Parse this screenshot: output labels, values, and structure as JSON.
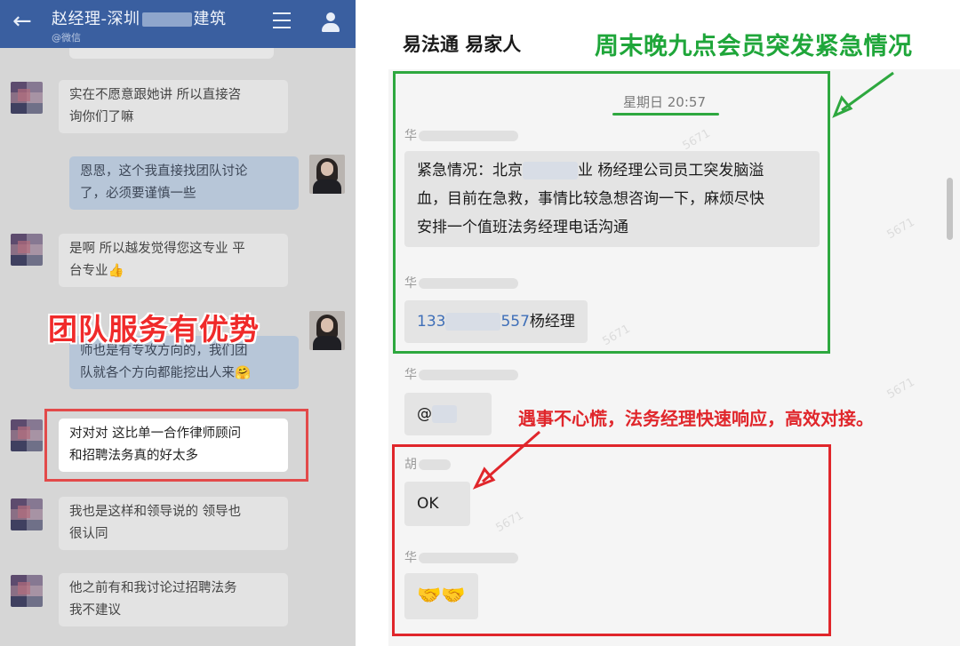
{
  "left_chat": {
    "title_start": "赵经理-深圳",
    "title_end": "建筑",
    "subtitle": "@微信",
    "messages": [
      {
        "side": "left",
        "text": "实在不愿意跟她讲 所以直接咨\n询你们了嘛"
      },
      {
        "side": "right",
        "text": "恩恩，这个我直接找团队讨论\n了，必须要谨慎一些"
      },
      {
        "side": "left",
        "text": "是啊 所以越发觉得您这专业 平\n台专业👍"
      },
      {
        "side": "right",
        "text": "师也是有专攻方向的，我们团\n队就各个方向都能挖出人来🤗"
      },
      {
        "side": "left",
        "text": "对对对 这比单一合作律师顾问\n和招聘法务真的好太多"
      },
      {
        "side": "left",
        "text": "我也是这样和领导说的 领导也\n很认同"
      },
      {
        "side": "left",
        "text": "他之前有和我讨论过招聘法务\n我不建议"
      }
    ],
    "overlay_caption": "团队服务有优势"
  },
  "right_chat": {
    "group_name": "易法通 易家人",
    "green_headline": "周末晚九点会员突发紧急情况",
    "timestamp": "星期日 20:57",
    "sender_hua": "华",
    "sender_hu": "胡",
    "urgent_msg_line1_start": "紧急情况：北京",
    "urgent_msg_line1_end": "业  杨经理公司员工突发脑溢",
    "urgent_msg_line2": "血，目前在急救，事情比较急想咨询一下，麻烦尽快",
    "urgent_msg_line3": "安排一个值班法务经理电话沟通",
    "phone_prefix": "133",
    "phone_suffix": "557",
    "phone_name": "杨经理",
    "at_msg": "@",
    "ok_msg": "OK",
    "handshake_msg": "🤝🤝",
    "red_headline": "遇事不心慌，法务经理快速响应，高效对接。"
  },
  "colors": {
    "green_accent": "#2ea83f",
    "red_accent": "#e0262b",
    "left_topbar": "#3a5fa0"
  }
}
